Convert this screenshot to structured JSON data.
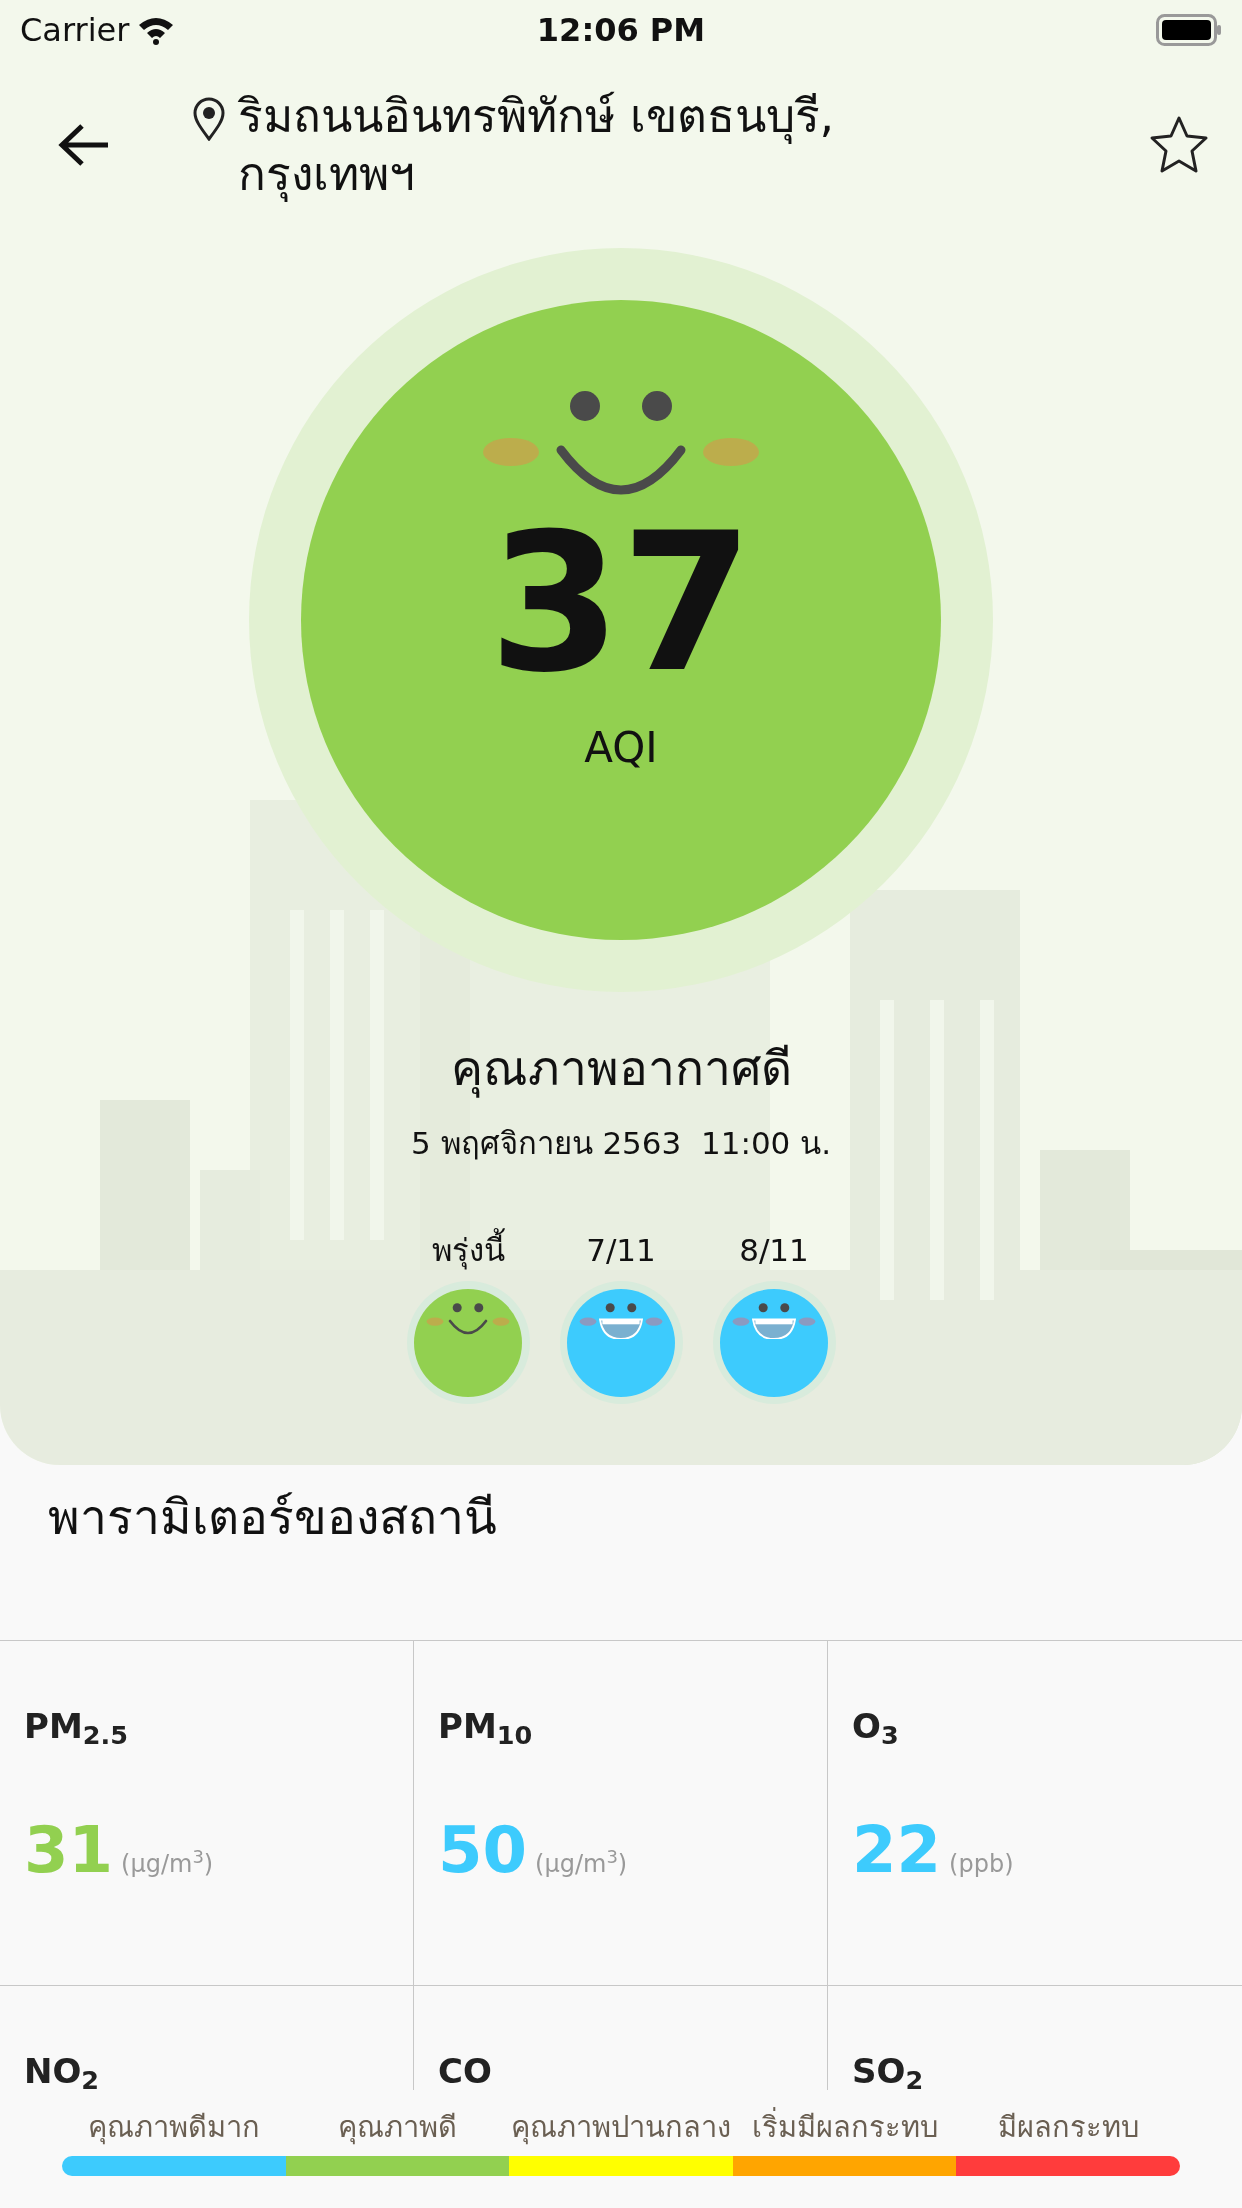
{
  "status_bar": {
    "carrier": "Carrier",
    "time": "12:06 PM"
  },
  "header": {
    "location": "ริมถนนอินทรพิทักษ์ เขตธนบุรี, กรุงเทพฯ",
    "favorite": false
  },
  "aqi": {
    "value": "37",
    "unit": "AQI",
    "color": "#92d050",
    "kind": "smile"
  },
  "quality": "คุณภาพอากาศดี",
  "timestamp": "5 พฤศจิกายน 2563  11:00 น.",
  "forecast": [
    {
      "label": "พรุ่งนี้",
      "color": "#92d050",
      "kind": "smile"
    },
    {
      "label": "7/11",
      "color": "#3dcbfd",
      "kind": "grin"
    },
    {
      "label": "8/11",
      "color": "#3dcbfd",
      "kind": "grin"
    }
  ],
  "parameters": {
    "title": "พารามิเตอร์ของสถานี",
    "items": [
      {
        "name": "PM$_{2.5}$",
        "value": "31",
        "unit": "(µg/m$^{3}$)",
        "color": "#92d050"
      },
      {
        "name": "PM$_{10}$",
        "value": "50",
        "unit": "(µg/m$^{3}$)",
        "color": "#3dcbfd"
      },
      {
        "name": "O$_{3}$",
        "value": "22",
        "unit": "(ppb)",
        "color": "#3dcbfd"
      },
      {
        "name": "NO$_{2}$"
      },
      {
        "name": "CO"
      },
      {
        "name": "SO$_{2}$"
      }
    ]
  },
  "legend": [
    {
      "label": "คุณภาพดีมาก",
      "color": "#3dcbfd"
    },
    {
      "label": "คุณภาพดี",
      "color": "#92d050"
    },
    {
      "label": "คุณภาพปานกลาง",
      "color": "#ffff00"
    },
    {
      "label": "เริ่มมีผลกระทบ",
      "color": "#ffa500"
    },
    {
      "label": "มีผลกระทบ",
      "color": "#ff3c3c"
    }
  ]
}
